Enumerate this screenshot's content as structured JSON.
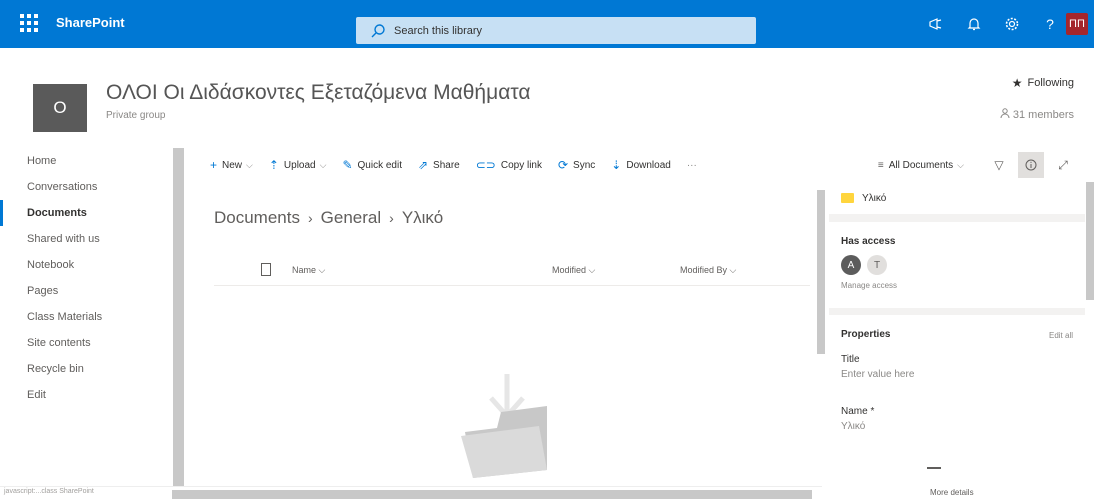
{
  "suitebar": {
    "app_name": "SharePoint",
    "search_placeholder": "Search this library",
    "avatar_initials": "ΠΠ",
    "icons": [
      "megaphone-icon",
      "bell-icon",
      "gear-icon",
      "help-icon"
    ]
  },
  "site": {
    "logo_letter": "Ο",
    "title": "ΟΛΟΙ Οι Διδάσκοντες Εξεταζόμενα Μαθήματα",
    "subtitle": "Private group",
    "following_label": "Following",
    "members_label": "31 members"
  },
  "nav": {
    "items": [
      {
        "label": "Home",
        "active": false
      },
      {
        "label": "Conversations",
        "active": false
      },
      {
        "label": "Documents",
        "active": true
      },
      {
        "label": "Shared with us",
        "active": false
      },
      {
        "label": "Notebook",
        "active": false
      },
      {
        "label": "Pages",
        "active": false
      },
      {
        "label": "Class Materials",
        "active": false
      },
      {
        "label": "Site contents",
        "active": false
      },
      {
        "label": "Recycle bin",
        "active": false
      },
      {
        "label": "Edit",
        "active": false
      }
    ]
  },
  "commandbar": {
    "new": "New",
    "upload": "Upload",
    "quick_edit": "Quick edit",
    "share": "Share",
    "copy_link": "Copy link",
    "sync": "Sync",
    "download": "Download",
    "more": "···",
    "view": "All Documents"
  },
  "breadcrumb": [
    "Documents",
    "General",
    "Υλικό"
  ],
  "list": {
    "columns": [
      "Name",
      "Modified",
      "Modified By"
    ]
  },
  "details": {
    "folder_name": "Υλικό",
    "has_access_label": "Has access",
    "avatar1": "Α",
    "avatar2": "Τ",
    "manage_access": "Manage access",
    "properties_label": "Properties",
    "edit_all": "Edit all",
    "title_label": "Title",
    "title_placeholder": "Enter value here",
    "name_label": "Name *",
    "name_value": "Υλικό",
    "more_details": "More details"
  },
  "status_text": "javascript:...class SharePoint",
  "colors": {
    "suitebar": "#0078d4",
    "accent": "#0078d4",
    "avatar": "#a4262c",
    "folder": "#ffd53d"
  }
}
